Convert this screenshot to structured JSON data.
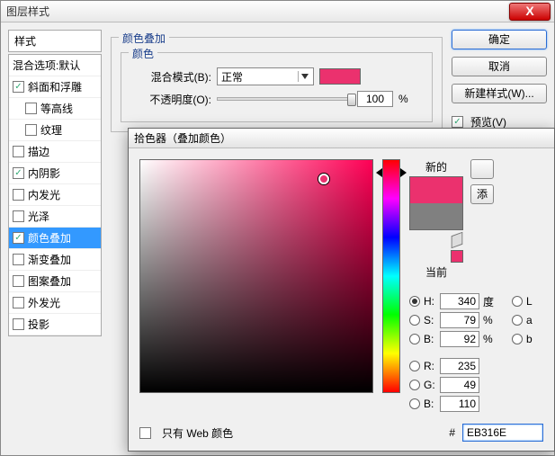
{
  "main_dialog": {
    "title": "图层样式",
    "styles_header": "样式",
    "blend_options_label": "混合选项:默认",
    "items": [
      {
        "label": "斜面和浮雕",
        "checked": true,
        "indent": false
      },
      {
        "label": "等高线",
        "checked": false,
        "indent": true
      },
      {
        "label": "纹理",
        "checked": false,
        "indent": true
      },
      {
        "label": "描边",
        "checked": false,
        "indent": false
      },
      {
        "label": "内阴影",
        "checked": true,
        "indent": false
      },
      {
        "label": "内发光",
        "checked": false,
        "indent": false
      },
      {
        "label": "光泽",
        "checked": false,
        "indent": false
      },
      {
        "label": "颜色叠加",
        "checked": true,
        "indent": false,
        "selected": true
      },
      {
        "label": "渐变叠加",
        "checked": false,
        "indent": false
      },
      {
        "label": "图案叠加",
        "checked": false,
        "indent": false
      },
      {
        "label": "外发光",
        "checked": false,
        "indent": false
      },
      {
        "label": "投影",
        "checked": false,
        "indent": false
      }
    ],
    "overlay_group_title": "颜色叠加",
    "color_group_title": "颜色",
    "blend_mode_label": "混合模式(B):",
    "blend_mode_value": "正常",
    "opacity_label": "不透明度(O):",
    "opacity_value": "100",
    "opacity_unit": "%",
    "swatch_color": "#eb316e",
    "buttons": {
      "ok": "确定",
      "cancel": "取消",
      "new_style": "新建样式(W)...",
      "preview": "预览(V)"
    }
  },
  "picker_dialog": {
    "title": "拾色器（叠加颜色）",
    "new_label": "新的",
    "current_label": "当前",
    "new_color": "#eb316e",
    "current_color": "#808080",
    "web_only_label": "只有 Web 颜色",
    "hex_prefix": "#",
    "hex_value": "EB316E",
    "hsb": {
      "H": {
        "label": "H:",
        "value": "340",
        "unit": "度",
        "selected": true
      },
      "S": {
        "label": "S:",
        "value": "79",
        "unit": "%"
      },
      "B": {
        "label": "B:",
        "value": "92",
        "unit": "%"
      }
    },
    "rgb": {
      "R": {
        "label": "R:",
        "value": "235"
      },
      "G": {
        "label": "G:",
        "value": "49"
      },
      "B": {
        "label": "B:",
        "value": "110"
      }
    },
    "lab_radios": [
      "L",
      "a",
      "b"
    ],
    "add_button": "添",
    "sv_cursor": {
      "x_pct": 79,
      "y_pct": 8
    },
    "hue_pos_pct": 5.5
  }
}
